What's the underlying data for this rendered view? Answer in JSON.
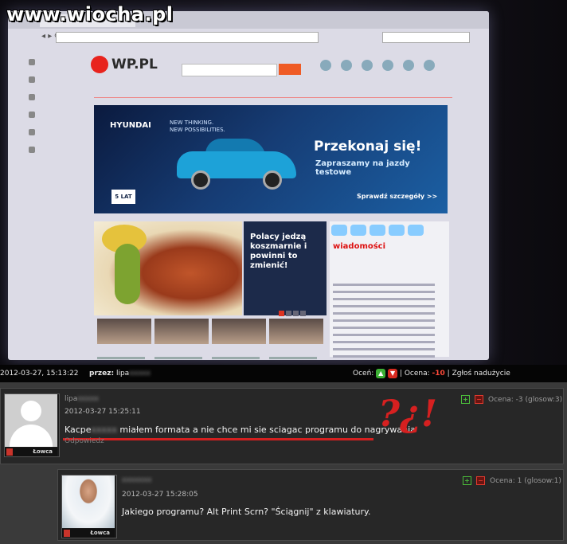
{
  "watermark": "www.wiocha.pl",
  "screen": {
    "wp_logo": "WP.PL",
    "ad": {
      "brand": "HYUNDAI",
      "slogan_1": "NEW THINKING.",
      "slogan_2": "NEW POSSIBILITIES.",
      "headline": "Przekonaj się!",
      "sub": "Zapraszamy na jazdy testowe",
      "more": "Sprawdź szczegóły >>",
      "badge": "5 LAT"
    },
    "headline": "Polacy jedzą koszmarnie i powinni to zmienić!",
    "news_title": "wiadomości"
  },
  "post_info": {
    "date": "2012-03-27, 15:13:22",
    "author_label": "przez:",
    "author_name": "lipa",
    "author_blur": "xxxxx",
    "rate_label": "Oceń:",
    "score_label": "| Ocena:",
    "score_value": "-10",
    "report": "| Zgłoś nadużycie"
  },
  "comments": [
    {
      "author": "lipa",
      "author_blur": "xxxxx",
      "date": "2012-03-27 15:25:11",
      "text_prefix": "Kacpe",
      "text_blur": "xxxxx",
      "text": " miałem formata a nie chce mi sie sciagac programu do nagrywania",
      "reply": "Odpowiedz",
      "rank": "Łowca",
      "vote_plus": "+",
      "vote_minus": "−",
      "score": "Ocena: -3 (glosow:3)",
      "scribble": "?¿!"
    },
    {
      "author_blur": "xxxxxxx",
      "date": "2012-03-27 15:28:05",
      "text": "Jakiego programu? Alt Print Scrn? \"Ściągnij\" z klawiatury.",
      "rank": "Łowca",
      "vote_plus": "+",
      "vote_minus": "−",
      "score": "Ocena: 1 (glosow:1)"
    }
  ]
}
